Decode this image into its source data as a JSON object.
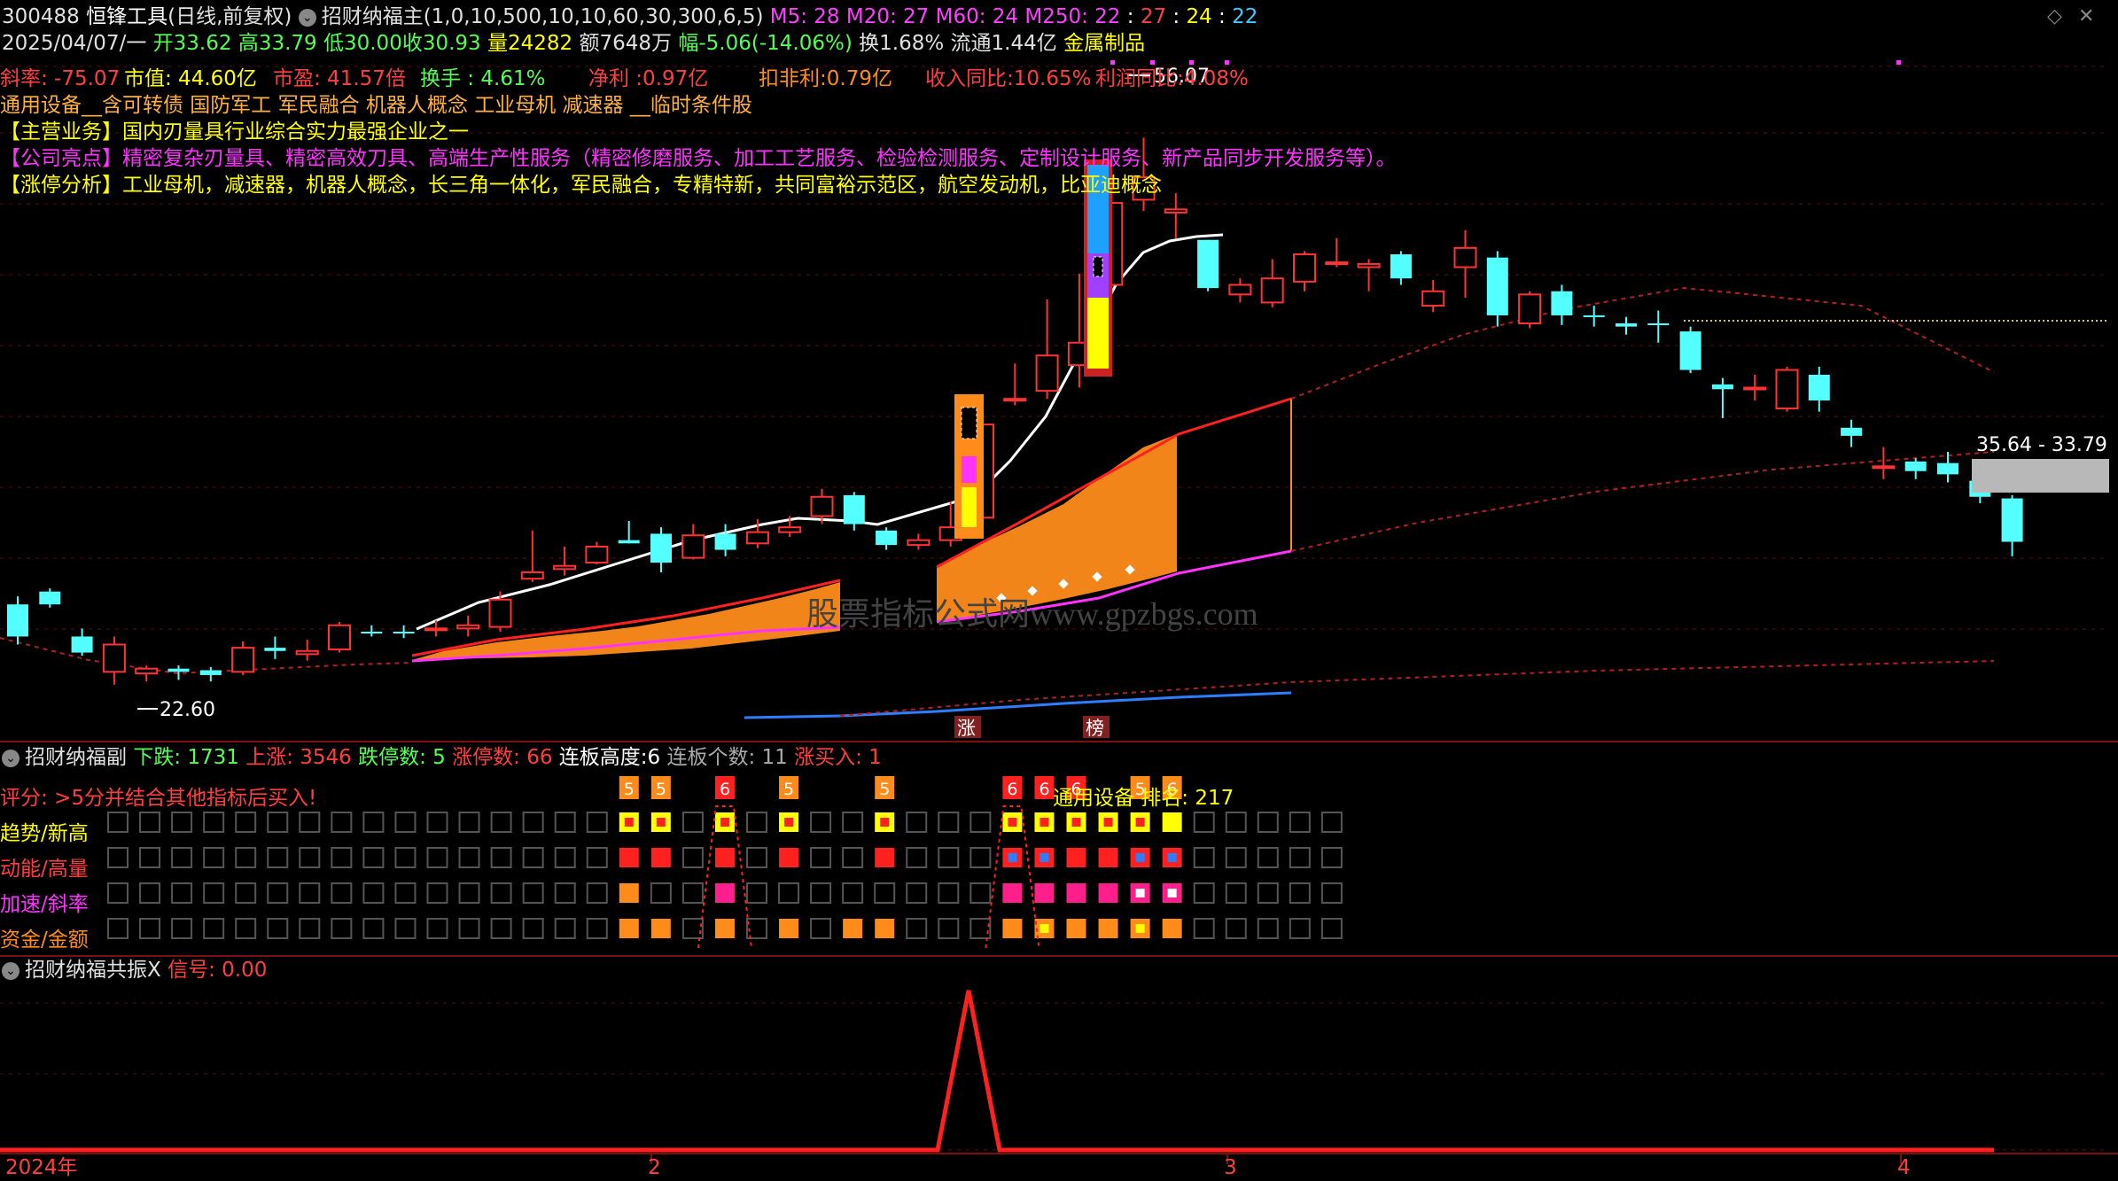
{
  "header": {
    "code": "300488",
    "name": "恒锋工具",
    "period": "(日线,前复权)",
    "indicator": "招财纳福主(1,0,10,500,10,10,60,30,300,6,5)",
    "ma": [
      {
        "label": "M5: 28",
        "color": "#ff3fff"
      },
      {
        "label": "M20: 27",
        "color": "#ff3fff"
      },
      {
        "label": "M60: 24",
        "color": "#ff3fff"
      },
      {
        "label": "M250: 22",
        "color": "#ff3fff"
      },
      {
        "label": ":",
        "color": "#ffffff"
      },
      {
        "label": "27",
        "color": "#ff3f3f"
      },
      {
        "label": ":",
        "color": "#ffffff"
      },
      {
        "label": "24",
        "color": "#ffff00"
      },
      {
        "label": ":",
        "color": "#ffffff"
      },
      {
        "label": "22",
        "color": "#40c8ff"
      }
    ]
  },
  "quote": {
    "date": "2025/04/07/一",
    "open": "开33.62",
    "high": "高33.79",
    "low": "低30.00",
    "close": "收30.93",
    "volume": "量24282",
    "amount": "额7648万",
    "change": "幅-5.06(-14.06%)",
    "turnover": "换1.68%",
    "float": "流通1.44亿",
    "sector": "金属制品"
  },
  "stats": {
    "slope": "斜率: -75.07",
    "mktcap": "市值: 44.60亿",
    "pe": "市盈: 41.57倍",
    "turn": "换手 : 4.61%",
    "profit": "净利 :0.97亿",
    "deduct": "扣非利:0.79亿",
    "rev_yoy": "收入同比:10.65%",
    "profit_yoy": "利润同比:4.08%"
  },
  "concepts": "通用设备__含可转债 国防军工 军民融合 机器人概念 工业母机 减速器 __临时条件股",
  "info": {
    "main_label": "【主营业务】",
    "main": "国内刃量具行业综合实力最强企业之一",
    "highlight_label": "【公司亮点】",
    "highlight": "精密复杂刃量具、精密高效刀具、高端生产性服务（精密修磨服务、加工工艺服务、检验检测服务、定制设计服务、新产品同步开发服务等）。",
    "limitup_label": "【涨停分析】",
    "limitup": "工业母机，减速器，机器人概念，长三角一体化，军民融合，专精特新，共同富裕示范区，航空发动机，比亚迪概念"
  },
  "chart_labels": {
    "high_mark": "56.07",
    "low_mark": "22.60",
    "range_mark": "35.64 - 33.79",
    "tag_zhang": "涨",
    "tag_bang": "榜",
    "watermark": "股票指标公式网www.gpzbgs.com"
  },
  "sub_panel": {
    "title": "招财纳福副",
    "down": "下跌: 1731",
    "up": "上涨: 3546",
    "limitdown": "跌停数: 5",
    "limitup": "涨停数: 66",
    "height_label": "连板高度:",
    "height_val": "6",
    "count": "连板个数: 11",
    "buy": "涨买入: 1",
    "score": "评分: >5分并结合其他指标后买入!",
    "rank": "通用设备 排名: 217",
    "rows": [
      "趋势/新高",
      "动能/高量",
      "加速/斜率",
      "资金/金额"
    ],
    "badges": [
      "5",
      "5",
      "6",
      "5",
      "5",
      "6",
      "6",
      "6",
      "5",
      "6"
    ]
  },
  "res_panel": {
    "title": "招财纳福共振X",
    "signal": "信号: 0.00"
  },
  "time_axis": [
    "2024年",
    "2",
    "3",
    "4"
  ],
  "colors": {
    "up": "#ff3333",
    "down": "#54ffff",
    "white_line": "#ffffff",
    "orange": "#ff8c1a",
    "magenta": "#ff33ff",
    "blue": "#2d7fff",
    "border": "#7a1010"
  },
  "chart_data": {
    "type": "candlestick",
    "candles": [
      {
        "o": 27.0,
        "c": 25.0,
        "h": 27.5,
        "l": 24.5
      },
      {
        "o": 27.8,
        "c": 27.0,
        "h": 28.0,
        "l": 26.8
      },
      {
        "o": 25.0,
        "c": 24.0,
        "h": 25.5,
        "l": 23.8
      },
      {
        "o": 22.8,
        "c": 24.5,
        "h": 25.0,
        "l": 22.0
      },
      {
        "o": 22.7,
        "c": 23.0,
        "h": 23.2,
        "l": 22.2
      },
      {
        "o": 23.0,
        "c": 22.8,
        "h": 23.2,
        "l": 22.3
      },
      {
        "o": 22.9,
        "c": 22.6,
        "h": 23.1,
        "l": 22.2
      },
      {
        "o": 22.8,
        "c": 24.3,
        "h": 24.7,
        "l": 22.6
      },
      {
        "o": 24.3,
        "c": 24.1,
        "h": 25.0,
        "l": 23.6
      },
      {
        "o": 23.9,
        "c": 24.1,
        "h": 24.8,
        "l": 23.5
      },
      {
        "o": 24.2,
        "c": 25.7,
        "h": 25.9,
        "l": 24.0
      },
      {
        "o": 25.3,
        "c": 25.2,
        "h": 25.7,
        "l": 25.0
      },
      {
        "o": 25.3,
        "c": 25.2,
        "h": 25.7,
        "l": 24.9
      },
      {
        "o": 25.4,
        "c": 25.5,
        "h": 26.0,
        "l": 25.0
      },
      {
        "o": 25.5,
        "c": 25.7,
        "h": 26.3,
        "l": 25.0
      },
      {
        "o": 25.6,
        "c": 27.3,
        "h": 27.8,
        "l": 25.3
      },
      {
        "o": 28.6,
        "c": 29.0,
        "h": 31.6,
        "l": 28.4
      },
      {
        "o": 29.2,
        "c": 29.4,
        "h": 30.6,
        "l": 28.8
      },
      {
        "o": 29.6,
        "c": 30.6,
        "h": 30.9,
        "l": 29.5
      },
      {
        "o": 31.0,
        "c": 30.8,
        "h": 32.2,
        "l": 30.8
      },
      {
        "o": 31.4,
        "c": 29.6,
        "h": 31.8,
        "l": 29.0
      },
      {
        "o": 29.9,
        "c": 31.3,
        "h": 32.0,
        "l": 29.8
      },
      {
        "o": 31.4,
        "c": 30.4,
        "h": 32.0,
        "l": 30.0
      },
      {
        "o": 30.8,
        "c": 31.5,
        "h": 32.3,
        "l": 30.5
      },
      {
        "o": 31.5,
        "c": 31.8,
        "h": 32.5,
        "l": 31.2
      },
      {
        "o": 32.5,
        "c": 33.7,
        "h": 34.2,
        "l": 32.0
      },
      {
        "o": 33.8,
        "c": 32.0,
        "h": 34.0,
        "l": 31.6
      },
      {
        "o": 31.6,
        "c": 30.7,
        "h": 31.8,
        "l": 30.4
      },
      {
        "o": 30.7,
        "c": 31.0,
        "h": 31.4,
        "l": 30.4
      },
      {
        "o": 31.0,
        "c": 31.8,
        "h": 33.4,
        "l": 30.6
      },
      {
        "o": 32.4,
        "c": 38.2,
        "h": 38.4,
        "l": 32.4
      },
      {
        "o": 39.7,
        "c": 39.8,
        "h": 42.0,
        "l": 39.4
      },
      {
        "o": 40.3,
        "c": 42.5,
        "h": 46.0,
        "l": 39.8
      },
      {
        "o": 41.9,
        "c": 43.3,
        "h": 47.6,
        "l": 40.5
      },
      {
        "o": 46.9,
        "c": 52.0,
        "h": 53.7,
        "l": 46.3
      },
      {
        "o": 52.2,
        "c": 53.6,
        "h": 56.07,
        "l": 51.5
      },
      {
        "o": 51.4,
        "c": 51.6,
        "h": 52.6,
        "l": 49.8
      },
      {
        "o": 49.7,
        "c": 46.7,
        "h": 49.7,
        "l": 46.5
      },
      {
        "o": 46.3,
        "c": 46.9,
        "h": 47.3,
        "l": 45.8
      },
      {
        "o": 45.8,
        "c": 47.3,
        "h": 48.5,
        "l": 45.5
      },
      {
        "o": 47.1,
        "c": 48.8,
        "h": 49.0,
        "l": 46.5
      },
      {
        "o": 48.3,
        "c": 48.3,
        "h": 49.8,
        "l": 48.0
      },
      {
        "o": 48.0,
        "c": 48.2,
        "h": 48.5,
        "l": 46.5
      },
      {
        "o": 48.8,
        "c": 47.3,
        "h": 49.0,
        "l": 46.9
      },
      {
        "o": 45.6,
        "c": 46.5,
        "h": 47.2,
        "l": 45.2
      },
      {
        "o": 48.0,
        "c": 49.2,
        "h": 50.3,
        "l": 46.1
      },
      {
        "o": 48.6,
        "c": 45.0,
        "h": 49.0,
        "l": 44.3
      },
      {
        "o": 44.5,
        "c": 46.3,
        "h": 46.5,
        "l": 44.2
      },
      {
        "o": 46.5,
        "c": 45.0,
        "h": 46.9,
        "l": 44.4
      },
      {
        "o": 45.0,
        "c": 44.9,
        "h": 45.6,
        "l": 44.3
      },
      {
        "o": 44.5,
        "c": 44.3,
        "h": 44.9,
        "l": 43.8
      },
      {
        "o": 44.5,
        "c": 44.4,
        "h": 45.3,
        "l": 43.3
      },
      {
        "o": 44.0,
        "c": 41.6,
        "h": 44.3,
        "l": 41.4
      },
      {
        "o": 40.7,
        "c": 40.4,
        "h": 41.1,
        "l": 38.6
      },
      {
        "o": 40.5,
        "c": 40.5,
        "h": 41.3,
        "l": 39.7
      },
      {
        "o": 39.2,
        "c": 41.6,
        "h": 41.8,
        "l": 39.0
      },
      {
        "o": 41.3,
        "c": 39.7,
        "h": 41.8,
        "l": 39.0
      },
      {
        "o": 38.0,
        "c": 37.5,
        "h": 38.5,
        "l": 36.8
      },
      {
        "o": 35.6,
        "c": 35.6,
        "h": 36.8,
        "l": 34.8
      },
      {
        "o": 35.9,
        "c": 35.3,
        "h": 36.1,
        "l": 34.8
      },
      {
        "o": 35.8,
        "c": 35.1,
        "h": 36.5,
        "l": 34.6
      },
      {
        "o": 34.7,
        "c": 33.7,
        "h": 34.8,
        "l": 33.3
      },
      {
        "o": 33.6,
        "c": 30.9,
        "h": 33.8,
        "l": 30.0
      }
    ],
    "ylim": [
      20.5,
      60.5
    ],
    "signal_peak_index": 29
  }
}
